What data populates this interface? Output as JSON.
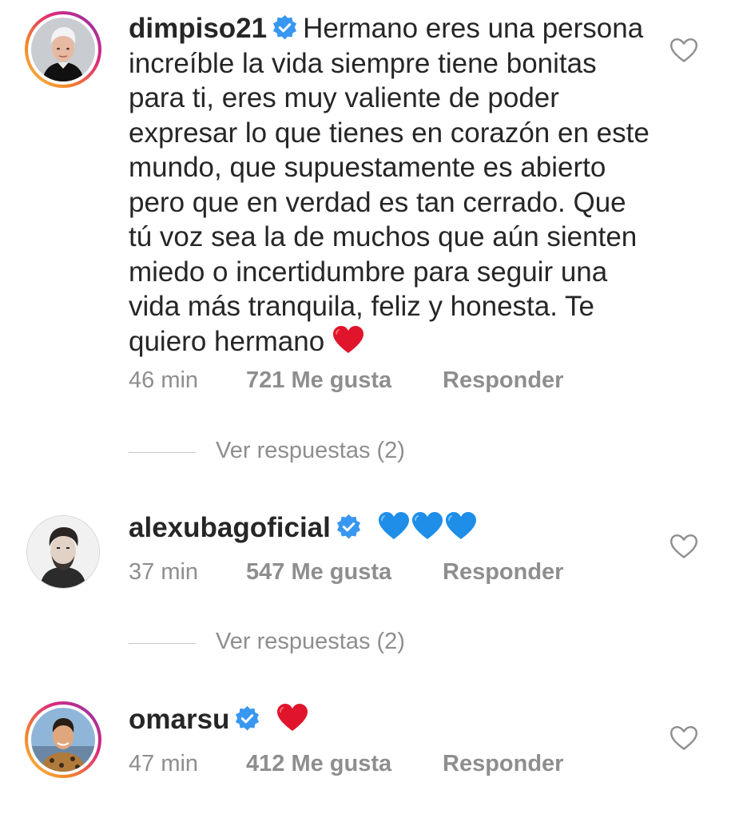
{
  "comments": [
    {
      "username": "dimpiso21",
      "text": "Hermano eres una persona increíble la vida siempre  tiene bonitas para ti, eres muy valiente de poder expresar lo que tienes en corazón en este mundo, que supuestamente es abierto pero que en verdad es tan cerrado. Que tú voz sea la de muchos que aún sienten miedo o incertidumbre para seguir una vida más tranquila, feliz y honesta. Te quiero hermano",
      "emoji": "red-heart",
      "time": "46 min",
      "likes": "721 Me gusta",
      "reply": "Responder",
      "view_replies": "Ver respuestas (2)"
    },
    {
      "username": "alexubagoficial",
      "text": "",
      "emoji": "blue-heart x3",
      "time": "37 min",
      "likes": "547 Me gusta",
      "reply": "Responder",
      "view_replies": "Ver respuestas (2)"
    },
    {
      "username": "omarsu",
      "text": "",
      "emoji": "red-heart",
      "time": "47 min",
      "likes": "412 Me gusta",
      "reply": "Responder"
    }
  ],
  "icons": {
    "verified": "verified-badge-icon",
    "like": "heart-outline-icon"
  },
  "colors": {
    "verified_blue": "#3897f0",
    "red_heart": "#e0142b",
    "blue_heart": "#1e8ee8",
    "meta_gray": "#8e8e8e"
  }
}
